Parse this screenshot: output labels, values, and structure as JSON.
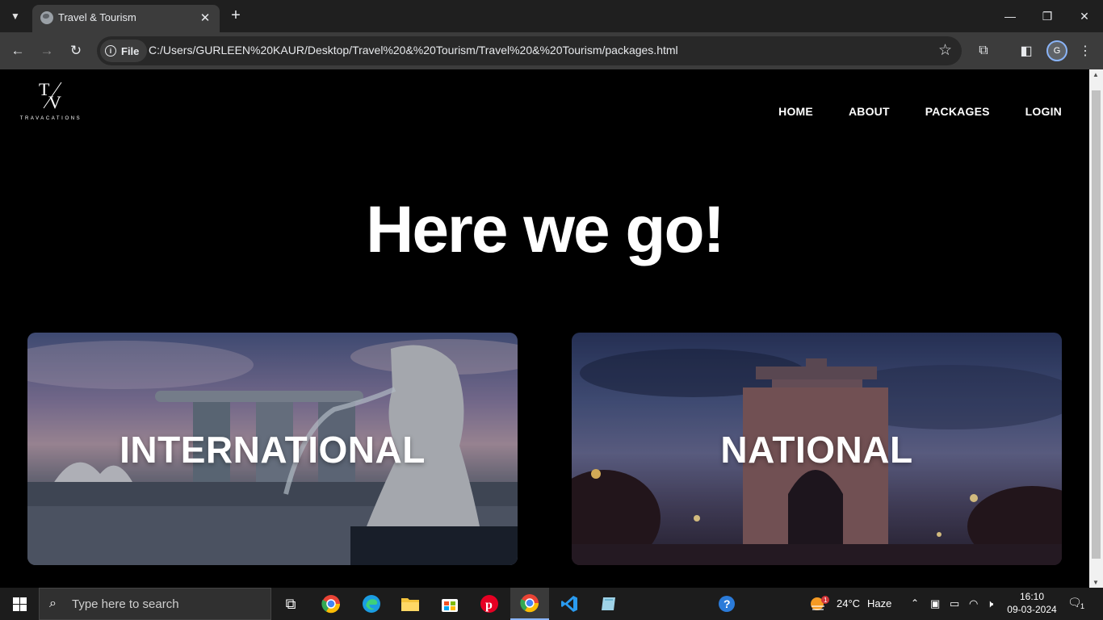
{
  "browser": {
    "tab_title": "Travel & Tourism",
    "site_chip": "File",
    "url": "C:/Users/GURLEEN%20KAUR/Desktop/Travel%20&%20Tourism/Travel%20&%20Tourism/packages.html",
    "profile_initial": "G"
  },
  "site": {
    "logo_monogram": "TV",
    "logo_text": "TRAVACATIONS",
    "nav": [
      "HOME",
      "ABOUT",
      "PACKAGES",
      "LOGIN"
    ],
    "hero_title": "Here we go!",
    "cards": [
      {
        "label": "INTERNATIONAL",
        "image": "singapore-merlion-marina-bay"
      },
      {
        "label": "NATIONAL",
        "image": "india-gate-dusk"
      }
    ]
  },
  "taskbar": {
    "search_placeholder": "Type here to search",
    "weather_temp": "24°C",
    "weather_desc": "Haze",
    "weather_badge": "1",
    "time": "16:10",
    "date": "09-03-2024",
    "notification_count": "1"
  },
  "colors": {
    "tabbar": "#1f1f1f",
    "toolbar": "#3c3c3c",
    "page_bg": "#000000",
    "accent": "#8ab4f8"
  }
}
